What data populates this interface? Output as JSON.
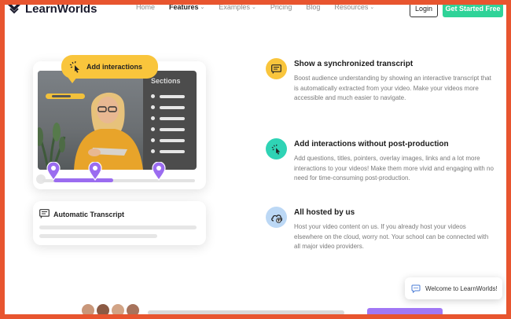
{
  "header": {
    "logo_text": "LearnWorlds",
    "nav": [
      {
        "label": "Home",
        "dropdown": false,
        "active": false
      },
      {
        "label": "Features",
        "dropdown": true,
        "active": true
      },
      {
        "label": "Examples",
        "dropdown": true,
        "active": false
      },
      {
        "label": "Pricing",
        "dropdown": false,
        "active": false
      },
      {
        "label": "Blog",
        "dropdown": false,
        "active": false
      },
      {
        "label": "Resources",
        "dropdown": true,
        "active": false
      }
    ],
    "login_label": "Login",
    "cta_label": "Get Started Free"
  },
  "illustration": {
    "bubble_label": "Add interactions",
    "sections_title": "Sections",
    "transcript_title": "Automatic Transcript"
  },
  "features": [
    {
      "icon": "transcript-icon",
      "title": "Show a synchronized transcript",
      "desc": "Boost audience understanding by showing an interactive transcript that is automatically extracted from your video. Make your videos more accessible and much easier to navigate."
    },
    {
      "icon": "pointer-click-icon",
      "title": "Add interactions without post-production",
      "desc": "Add questions, titles, pointers, overlay images, links and a lot more interactions to your videos! Make them more vivid and engaging with no need for time-consuming post-production."
    },
    {
      "icon": "cloud-upload-icon",
      "title": "All hosted by us",
      "desc": "Host your video content on us. If you already host your videos elsewhere on the cloud, worry not. Your school can be connected with all major video providers."
    }
  ],
  "chat": {
    "label": "Welcome to LearnWorlds!"
  },
  "colors": {
    "accent_green": "#2fd398",
    "accent_yellow": "#f9c53c",
    "accent_purple": "#9b6cf0",
    "frame_orange": "#e8552f",
    "icon_teal": "#2fd3b5",
    "icon_blue": "#bcd8f5"
  }
}
